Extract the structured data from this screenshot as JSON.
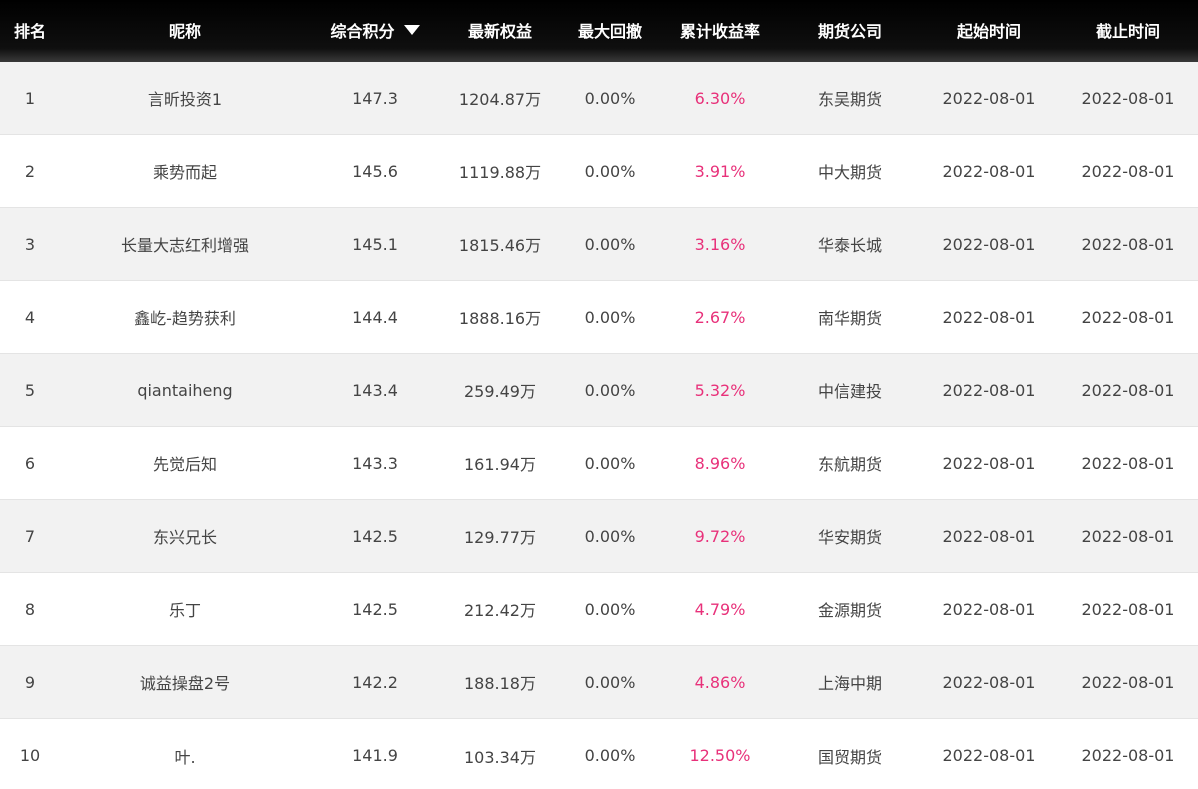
{
  "header": {
    "rank": "排名",
    "nickname": "昵称",
    "score": "综合积分",
    "equity": "最新权益",
    "max_drawdown": "最大回撤",
    "cum_return": "累计收益率",
    "company": "期货公司",
    "start": "起始时间",
    "end": "截止时间",
    "sort_icon": "caret-down-icon"
  },
  "colors": {
    "header_bg": "#000000",
    "return_text": "#e8317a",
    "row_alt_bg": "#f2f2f2"
  },
  "rows": [
    {
      "rank": "1",
      "nickname": "言昕投资1",
      "score": "147.3",
      "equity": "1204.87万",
      "max_drawdown": "0.00%",
      "cum_return": "6.30%",
      "company": "东吴期货",
      "start": "2022-08-01",
      "end": "2022-08-01"
    },
    {
      "rank": "2",
      "nickname": "乘势而起",
      "score": "145.6",
      "equity": "1119.88万",
      "max_drawdown": "0.00%",
      "cum_return": "3.91%",
      "company": "中大期货",
      "start": "2022-08-01",
      "end": "2022-08-01"
    },
    {
      "rank": "3",
      "nickname": "长量大志红利增强",
      "score": "145.1",
      "equity": "1815.46万",
      "max_drawdown": "0.00%",
      "cum_return": "3.16%",
      "company": "华泰长城",
      "start": "2022-08-01",
      "end": "2022-08-01"
    },
    {
      "rank": "4",
      "nickname": "鑫屹-趋势获利",
      "score": "144.4",
      "equity": "1888.16万",
      "max_drawdown": "0.00%",
      "cum_return": "2.67%",
      "company": "南华期货",
      "start": "2022-08-01",
      "end": "2022-08-01"
    },
    {
      "rank": "5",
      "nickname": "qiantaiheng",
      "score": "143.4",
      "equity": "259.49万",
      "max_drawdown": "0.00%",
      "cum_return": "5.32%",
      "company": "中信建投",
      "start": "2022-08-01",
      "end": "2022-08-01"
    },
    {
      "rank": "6",
      "nickname": "先觉后知",
      "score": "143.3",
      "equity": "161.94万",
      "max_drawdown": "0.00%",
      "cum_return": "8.96%",
      "company": "东航期货",
      "start": "2022-08-01",
      "end": "2022-08-01"
    },
    {
      "rank": "7",
      "nickname": "东兴兄长",
      "score": "142.5",
      "equity": "129.77万",
      "max_drawdown": "0.00%",
      "cum_return": "9.72%",
      "company": "华安期货",
      "start": "2022-08-01",
      "end": "2022-08-01"
    },
    {
      "rank": "8",
      "nickname": "乐丁",
      "score": "142.5",
      "equity": "212.42万",
      "max_drawdown": "0.00%",
      "cum_return": "4.79%",
      "company": "金源期货",
      "start": "2022-08-01",
      "end": "2022-08-01"
    },
    {
      "rank": "9",
      "nickname": "诚益操盘2号",
      "score": "142.2",
      "equity": "188.18万",
      "max_drawdown": "0.00%",
      "cum_return": "4.86%",
      "company": "上海中期",
      "start": "2022-08-01",
      "end": "2022-08-01"
    },
    {
      "rank": "10",
      "nickname": "叶.",
      "score": "141.9",
      "equity": "103.34万",
      "max_drawdown": "0.00%",
      "cum_return": "12.50%",
      "company": "国贸期货",
      "start": "2022-08-01",
      "end": "2022-08-01"
    }
  ]
}
